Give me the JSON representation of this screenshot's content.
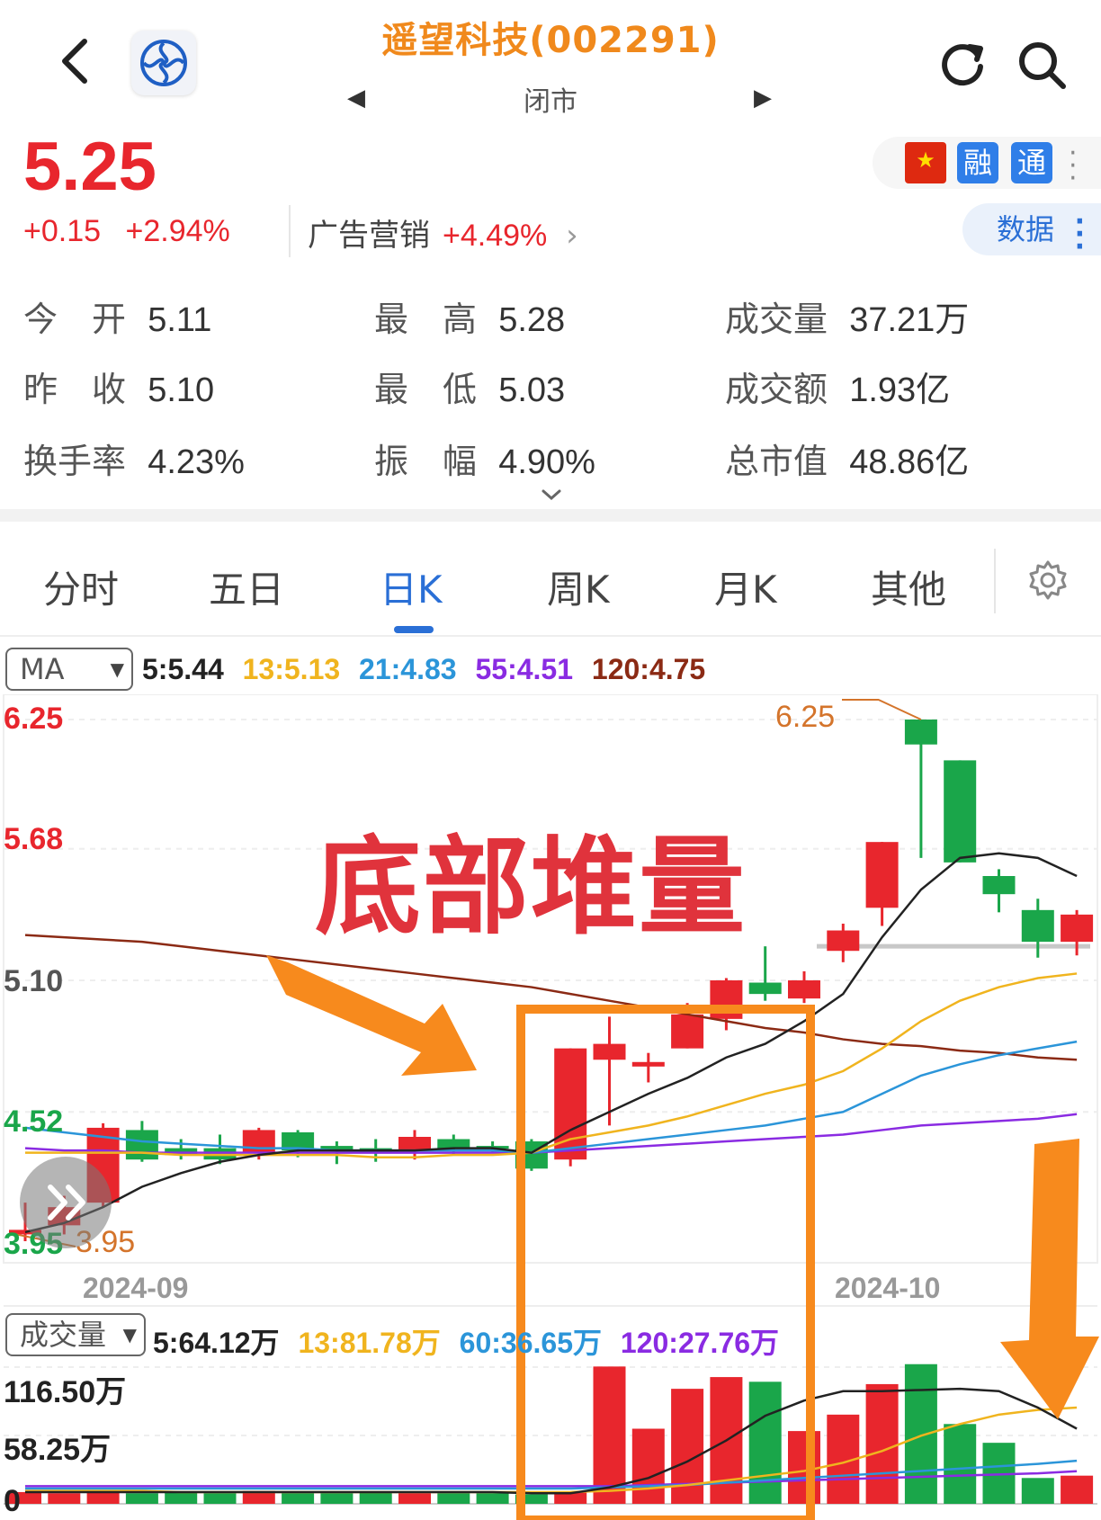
{
  "header": {
    "title": "遥望科技(002291)",
    "status": "闭市",
    "prev_label": "◀",
    "next_label": "▶"
  },
  "quote": {
    "price": "5.25",
    "change": "+0.15",
    "change_pct": "+2.94%",
    "sector_name": "广告营销",
    "sector_pct": "+4.49%",
    "sector_arrow": "›"
  },
  "badges": {
    "rong": "融",
    "tong": "通",
    "data_button": "数据"
  },
  "stats": {
    "open_label": "今　开",
    "open": "5.11",
    "high_label": "最　高",
    "high": "5.28",
    "volume_label": "成交量",
    "volume": "37.21万",
    "prev_close_label": "昨　收",
    "prev_close": "5.10",
    "low_label": "最　低",
    "low": "5.03",
    "amount_label": "成交额",
    "amount": "1.93亿",
    "turnover_label": "换手率",
    "turnover": "4.23%",
    "amplitude_label": "振　幅",
    "amplitude": "4.90%",
    "mktcap_label": "总市值",
    "mktcap": "48.86亿"
  },
  "tabs": [
    "分时",
    "五日",
    "日K",
    "周K",
    "月K",
    "其他"
  ],
  "active_tab": "日K",
  "ma_row": {
    "select": "MA",
    "ma5": "5:5.44",
    "ma13": "13:5.13",
    "ma21": "21:4.83",
    "ma55": "55:4.51",
    "ma120": "120:4.75"
  },
  "price_axis": {
    "top": "6.25",
    "mid1": "5.68",
    "mid2": "5.10",
    "low": "4.52",
    "bottom": "3.95"
  },
  "markers": {
    "max_label": "6.25",
    "min_label": "3.95"
  },
  "dates": {
    "d1": "2024-09",
    "d2": "2024-10"
  },
  "overlay_text": "底部堆量",
  "vol_row": {
    "select": "成交量",
    "v5": "5:64.12万",
    "v13": "13:81.78万",
    "v60": "60:36.65万",
    "v120": "120:27.76万"
  },
  "vol_axis": {
    "top": "116.50万",
    "mid": "58.25万",
    "zero": "0"
  },
  "colors": {
    "up": "#e8262d",
    "down": "#1aa64a",
    "ma5": "#222222",
    "ma13": "#f0b41e",
    "ma21": "#2b95d9",
    "ma55": "#8a2be2",
    "ma120": "#8b2a14",
    "annotation": "#f78a1d"
  },
  "chart_data": {
    "type": "candlestick",
    "price_ylim": [
      3.95,
      6.25
    ],
    "candles": [
      {
        "o": 3.98,
        "c": 4.0,
        "h": 4.12,
        "l": 3.95
      },
      {
        "o": 4.02,
        "c": 4.1,
        "h": 4.15,
        "l": 3.98
      },
      {
        "o": 4.12,
        "c": 4.45,
        "h": 4.47,
        "l": 4.1
      },
      {
        "o": 4.44,
        "c": 4.31,
        "h": 4.48,
        "l": 4.3
      },
      {
        "o": 4.36,
        "c": 4.33,
        "h": 4.4,
        "l": 4.31
      },
      {
        "o": 4.36,
        "c": 4.31,
        "h": 4.42,
        "l": 4.29
      },
      {
        "o": 4.34,
        "c": 4.44,
        "h": 4.45,
        "l": 4.31
      },
      {
        "o": 4.43,
        "c": 4.35,
        "h": 4.44,
        "l": 4.32
      },
      {
        "o": 4.37,
        "c": 4.35,
        "h": 4.39,
        "l": 4.29
      },
      {
        "o": 4.36,
        "c": 4.34,
        "h": 4.4,
        "l": 4.3
      },
      {
        "o": 4.35,
        "c": 4.41,
        "h": 4.44,
        "l": 4.31
      },
      {
        "o": 4.4,
        "c": 4.36,
        "h": 4.42,
        "l": 4.33
      },
      {
        "o": 4.37,
        "c": 4.36,
        "h": 4.39,
        "l": 4.34
      },
      {
        "o": 4.39,
        "c": 4.27,
        "h": 4.4,
        "l": 4.26
      },
      {
        "o": 4.31,
        "c": 4.8,
        "h": 4.8,
        "l": 4.28
      },
      {
        "o": 4.75,
        "c": 4.82,
        "h": 4.94,
        "l": 4.46
      },
      {
        "o": 4.72,
        "c": 4.74,
        "h": 4.78,
        "l": 4.65
      },
      {
        "o": 4.8,
        "c": 4.95,
        "h": 5.0,
        "l": 4.8
      },
      {
        "o": 4.93,
        "c": 5.1,
        "h": 5.11,
        "l": 4.88
      },
      {
        "o": 5.09,
        "c": 5.04,
        "h": 5.25,
        "l": 5.01
      },
      {
        "o": 5.02,
        "c": 5.1,
        "h": 5.14,
        "l": 5.0
      },
      {
        "o": 5.23,
        "c": 5.32,
        "h": 5.35,
        "l": 5.18
      },
      {
        "o": 5.42,
        "c": 5.71,
        "h": 5.71,
        "l": 5.34
      },
      {
        "o": 6.25,
        "c": 6.14,
        "h": 6.25,
        "l": 5.64
      },
      {
        "o": 6.07,
        "c": 5.62,
        "h": 6.07,
        "l": 5.62
      },
      {
        "o": 5.56,
        "c": 5.48,
        "h": 5.59,
        "l": 5.4
      },
      {
        "o": 5.41,
        "c": 5.27,
        "h": 5.46,
        "l": 5.2
      },
      {
        "o": 5.27,
        "c": 5.39,
        "h": 5.41,
        "l": 5.21
      }
    ],
    "ma5": [
      3.99,
      4.03,
      4.1,
      4.19,
      4.25,
      4.3,
      4.33,
      4.35,
      4.35,
      4.35,
      4.35,
      4.36,
      4.36,
      4.34,
      4.44,
      4.52,
      4.6,
      4.67,
      4.76,
      4.82,
      4.92,
      5.04,
      5.29,
      5.5,
      5.64,
      5.66,
      5.64,
      5.56
    ],
    "ma13": [
      4.34,
      4.34,
      4.34,
      4.34,
      4.33,
      4.33,
      4.33,
      4.33,
      4.33,
      4.32,
      4.32,
      4.33,
      4.33,
      4.34,
      4.4,
      4.43,
      4.46,
      4.5,
      4.55,
      4.6,
      4.64,
      4.7,
      4.8,
      4.92,
      5.01,
      5.07,
      5.11,
      5.13
    ],
    "ma21": [
      4.45,
      4.43,
      4.41,
      4.39,
      4.38,
      4.37,
      4.36,
      4.36,
      4.35,
      4.35,
      4.35,
      4.35,
      4.35,
      4.34,
      4.36,
      4.38,
      4.4,
      4.42,
      4.44,
      4.46,
      4.49,
      4.52,
      4.6,
      4.68,
      4.73,
      4.77,
      4.8,
      4.83
    ],
    "ma55": [
      4.36,
      4.35,
      4.35,
      4.34,
      4.34,
      4.34,
      4.34,
      4.34,
      4.34,
      4.34,
      4.34,
      4.34,
      4.34,
      4.34,
      4.35,
      4.36,
      4.37,
      4.38,
      4.39,
      4.4,
      4.41,
      4.42,
      4.44,
      4.46,
      4.47,
      4.48,
      4.49,
      4.51
    ],
    "ma120": [
      5.3,
      5.29,
      5.28,
      5.27,
      5.25,
      5.23,
      5.21,
      5.19,
      5.17,
      5.15,
      5.13,
      5.11,
      5.09,
      5.07,
      5.04,
      5.01,
      4.98,
      4.95,
      4.92,
      4.89,
      4.87,
      4.84,
      4.82,
      4.81,
      4.79,
      4.78,
      4.76,
      4.75
    ],
    "volume_ylim": [
      0,
      116.5
    ],
    "volume": [
      10,
      9,
      10,
      9,
      10,
      9,
      11,
      9,
      9,
      10,
      9,
      9,
      9,
      8,
      10,
      117,
      64,
      98,
      108,
      104,
      62,
      76,
      102,
      119,
      68,
      52,
      22,
      24
    ],
    "vol_ma5": [
      10,
      10,
      10,
      10,
      10,
      10,
      10,
      10,
      10,
      10,
      10,
      10,
      10,
      9,
      9,
      14,
      22,
      36,
      54,
      75,
      88,
      96,
      96,
      97,
      98,
      96,
      82,
      64
    ],
    "vol_ma13": [
      11,
      11,
      11,
      11,
      10,
      10,
      10,
      10,
      10,
      10,
      10,
      10,
      10,
      10,
      10,
      11,
      13,
      16,
      20,
      24,
      28,
      35,
      45,
      58,
      68,
      76,
      80,
      82
    ],
    "vol_ma60": [
      13,
      13,
      13,
      13,
      13,
      13,
      13,
      13,
      13,
      13,
      13,
      13,
      13,
      13,
      13,
      14,
      15,
      16,
      18,
      20,
      22,
      24,
      26,
      28,
      30,
      32,
      34,
      36.65
    ],
    "vol_ma120": [
      15,
      15,
      15,
      15,
      15,
      15,
      15,
      15,
      15,
      15,
      15,
      15,
      15,
      15,
      15,
      15,
      16,
      17,
      18,
      19,
      20,
      21,
      22,
      23,
      24,
      25,
      26,
      27.76
    ]
  }
}
